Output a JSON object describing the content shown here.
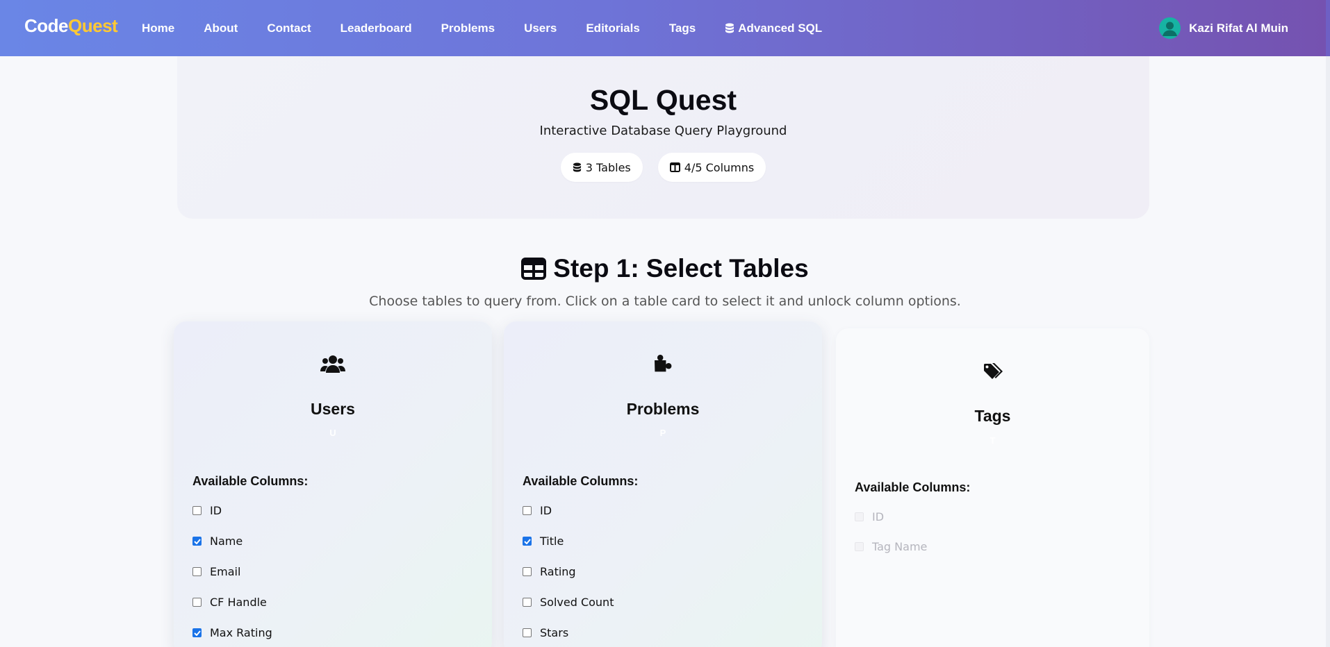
{
  "nav": {
    "brand_part1": "Code",
    "brand_part2": "Quest",
    "links": [
      "Home",
      "About",
      "Contact",
      "Leaderboard",
      "Problems",
      "Users",
      "Editorials",
      "Tags"
    ],
    "advanced": {
      "icon": "database-icon",
      "label": "Advanced SQL"
    },
    "user": {
      "name": "Kazi Rifat Al Muin",
      "icon": "user-avatar-icon"
    }
  },
  "hero": {
    "title": "SQL Quest",
    "subtitle": "Interactive Database Query Playground",
    "tables_pill": "3 Tables",
    "columns_pill": "4/5 Columns"
  },
  "step": {
    "title": "Step 1: Select Tables",
    "description": "Choose tables to query from. Click on a table card to select it and unlock column options."
  },
  "cards": [
    {
      "name": "Users",
      "alias": "U",
      "icon": "users-icon",
      "selected": true,
      "columns_label": "Available Columns:",
      "columns": [
        {
          "label": "ID",
          "checked": false
        },
        {
          "label": "Name",
          "checked": true
        },
        {
          "label": "Email",
          "checked": false
        },
        {
          "label": "CF Handle",
          "checked": false
        },
        {
          "label": "Max Rating",
          "checked": true
        }
      ]
    },
    {
      "name": "Problems",
      "alias": "P",
      "icon": "puzzle-icon",
      "selected": true,
      "columns_label": "Available Columns:",
      "columns": [
        {
          "label": "ID",
          "checked": false
        },
        {
          "label": "Title",
          "checked": true
        },
        {
          "label": "Rating",
          "checked": false
        },
        {
          "label": "Solved Count",
          "checked": false
        },
        {
          "label": "Stars",
          "checked": false
        }
      ]
    },
    {
      "name": "Tags",
      "alias": "T",
      "icon": "tags-icon",
      "selected": false,
      "columns_label": "Available Columns:",
      "columns": [
        {
          "label": "ID",
          "checked": false
        },
        {
          "label": "Tag Name",
          "checked": false
        }
      ]
    }
  ],
  "colors": {
    "nav_gradient_start": "#6a86e6",
    "nav_gradient_end": "#7552b0",
    "brand_accent": "#ffc933",
    "checkbox_checked": "#1a73e8",
    "avatar": "#17b3a3"
  }
}
